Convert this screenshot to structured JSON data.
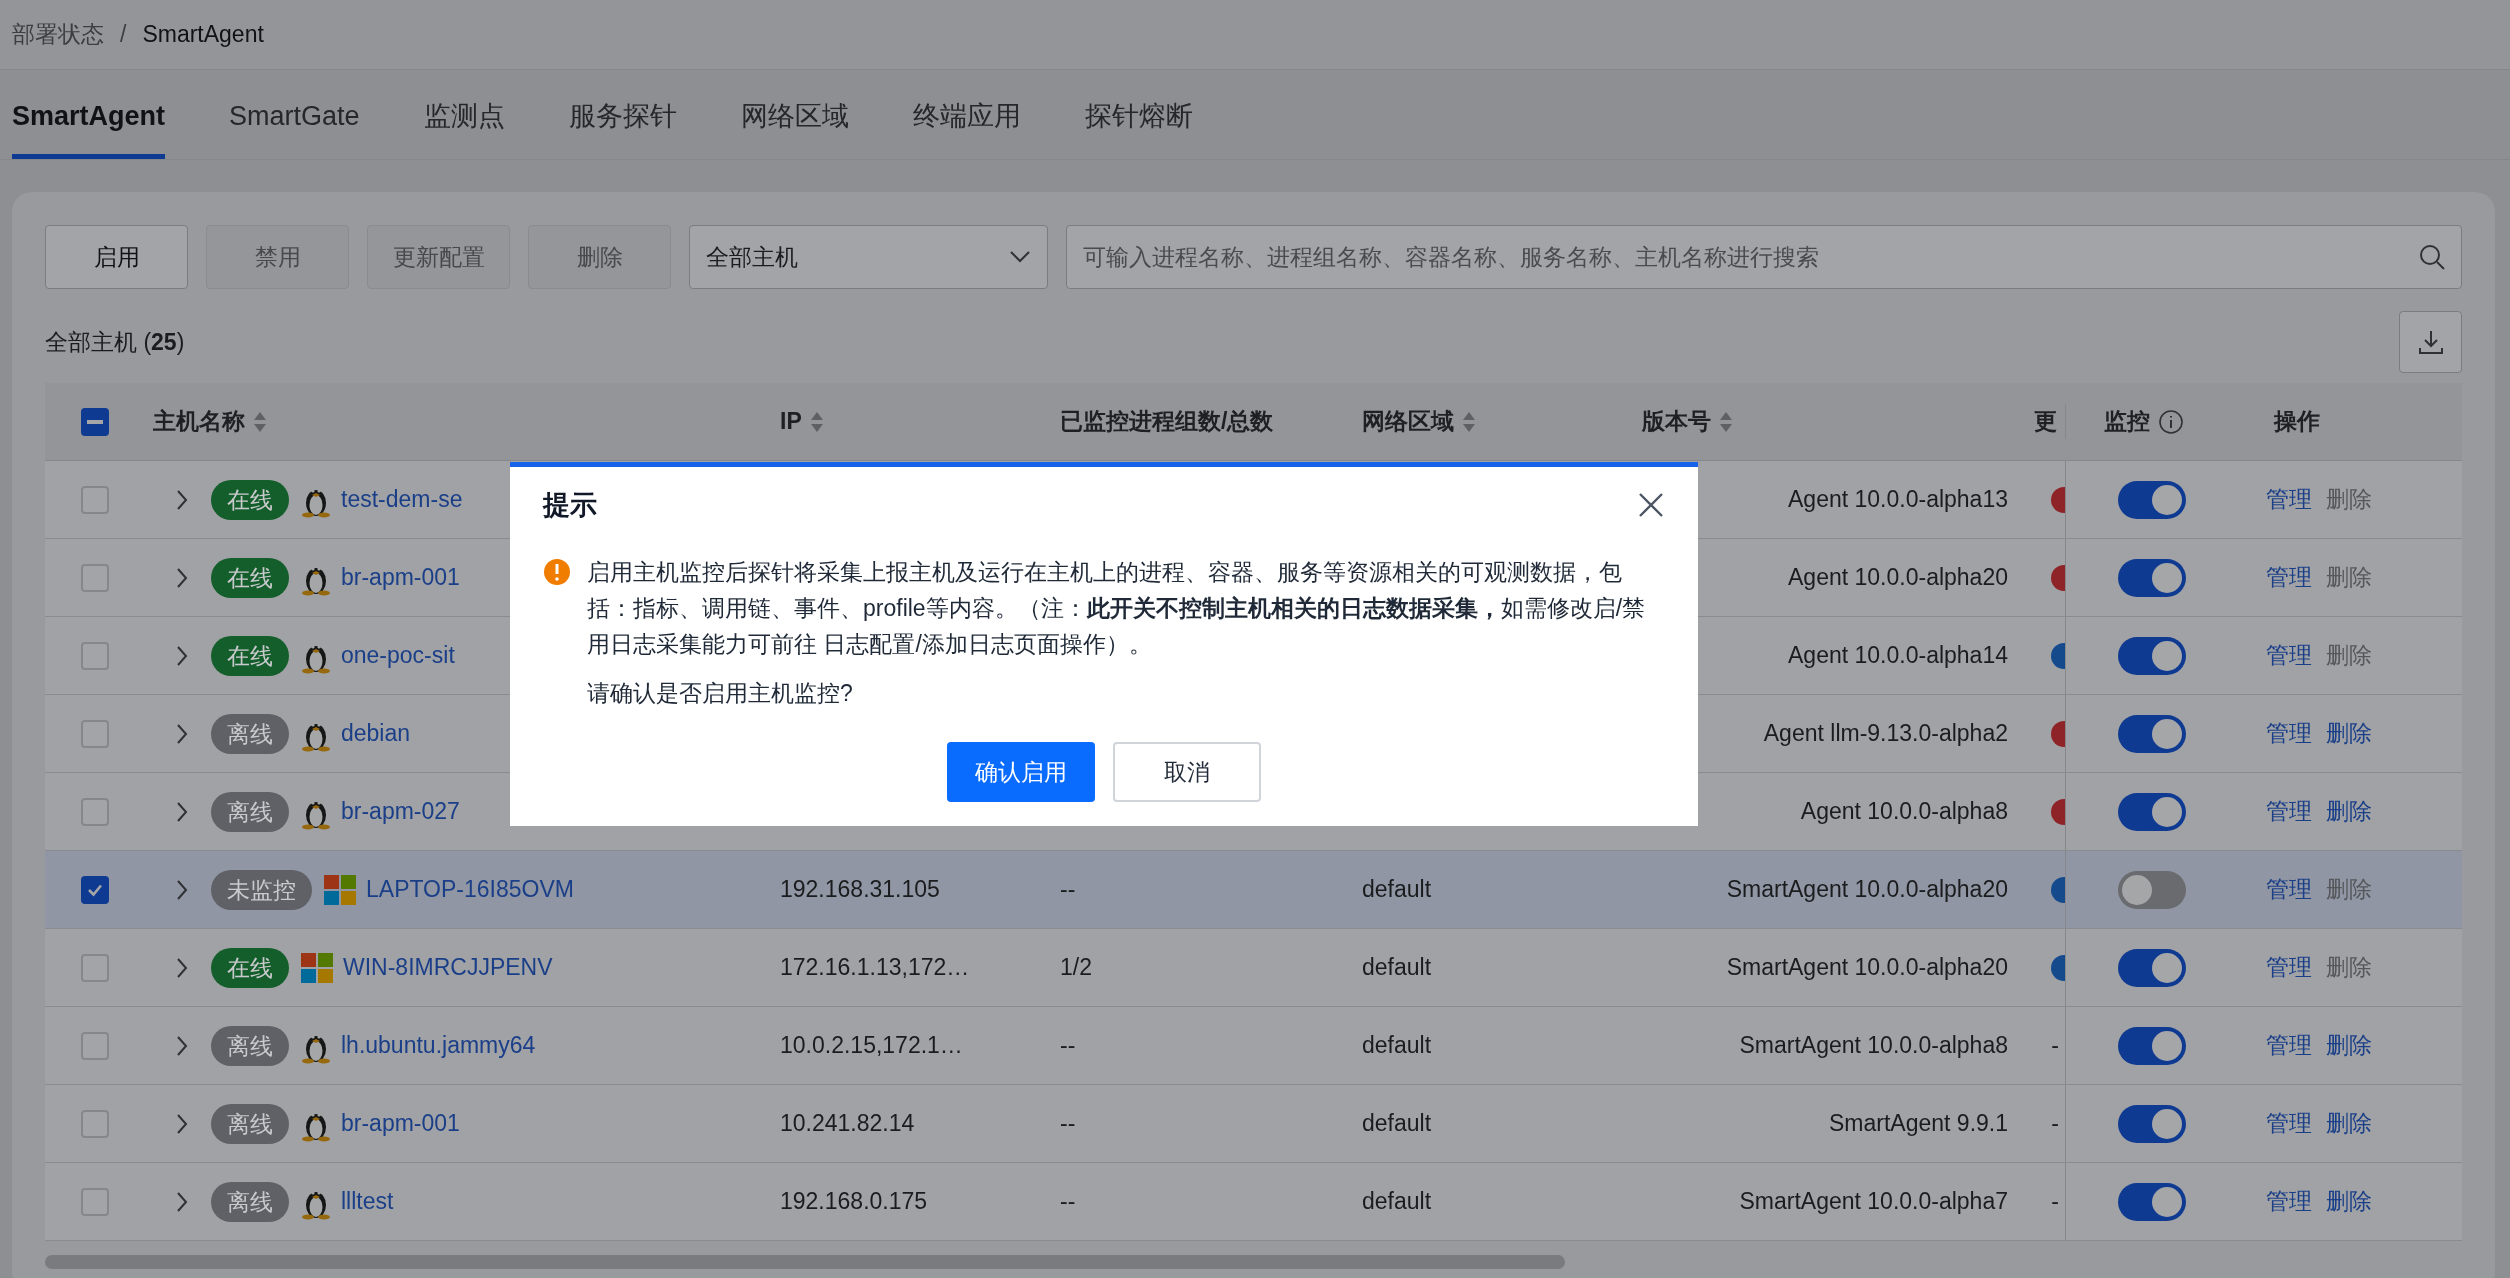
{
  "breadcrumb": [
    {
      "label": "部署状态",
      "current": false
    },
    {
      "label": "SmartAgent",
      "current": true
    }
  ],
  "breadcrumb_separator": "/",
  "tabs": [
    {
      "label": "SmartAgent",
      "selected": true
    },
    {
      "label": "SmartGate",
      "selected": false
    },
    {
      "label": "监测点",
      "selected": false
    },
    {
      "label": "服务探针",
      "selected": false
    },
    {
      "label": "网络区域",
      "selected": false
    },
    {
      "label": "终端应用",
      "selected": false
    },
    {
      "label": "探针熔断",
      "selected": false
    }
  ],
  "toolbar": {
    "buttons": [
      {
        "label": "启用",
        "disabled": false
      },
      {
        "label": "禁用",
        "disabled": true
      },
      {
        "label": "更新配置",
        "disabled": true
      },
      {
        "label": "删除",
        "disabled": true
      }
    ],
    "filter": {
      "value": "全部主机"
    },
    "search": {
      "placeholder": "可输入进程名称、进程组名称、容器名称、服务名称、主机名称进行搜索"
    }
  },
  "summary": "全部主机 (**25**)",
  "table": {
    "header_checkbox": {
      "indeterminate": true
    },
    "columns": [
      {
        "label": "主机名称",
        "sortable": true
      },
      {
        "label": "IP",
        "sortable": true
      },
      {
        "label": "已监控进程组数/总数",
        "sortable": false
      },
      {
        "label": "网络区域",
        "sortable": true
      },
      {
        "label": "版本号",
        "sortable": true
      },
      {
        "label": "更"
      },
      {
        "label": "监控",
        "sortable": false
      },
      {
        "label": "操作",
        "sortable": false
      }
    ],
    "rows": [
      {
        "checked": false,
        "status": {
          "label": "在线",
          "color": "#135e2a"
        },
        "host": {
          "kind": "linux",
          "name": "test-dem-se"
        },
        "version": "Agent 10.0.0-alpha13",
        "update": {
          "color": "#8e2428"
        },
        "monitor_on": true,
        "manage": "管理",
        "delete": {
          "label": "删除",
          "disabled": true
        }
      },
      {
        "checked": false,
        "status": {
          "label": "在线",
          "color": "#135e2a"
        },
        "host": {
          "kind": "linux",
          "name": "br-apm-001"
        },
        "version": "Agent 10.0.0-alpha20",
        "update": {
          "color": "#8e2428"
        },
        "monitor_on": true,
        "manage": "管理",
        "delete": {
          "label": "删除",
          "disabled": true
        }
      },
      {
        "checked": false,
        "status": {
          "label": "在线",
          "color": "#135e2a"
        },
        "host": {
          "kind": "linux",
          "name": "one-poc-sit"
        },
        "version": "Agent 10.0.0-alpha14",
        "update": {
          "color": "#154a8c"
        },
        "monitor_on": true,
        "manage": "管理",
        "delete": {
          "label": "删除",
          "disabled": true
        }
      },
      {
        "checked": false,
        "status": {
          "label": "离线",
          "color": "#5f6166"
        },
        "host": {
          "kind": "linux",
          "name": "debian"
        },
        "version": "Agent llm-9.13.0-alpha2",
        "update": {
          "color": "#8e2428"
        },
        "monitor_on": true,
        "manage": "管理",
        "delete": {
          "label": "删除",
          "disabled": false
        }
      },
      {
        "checked": false,
        "status": {
          "label": "离线",
          "color": "#5f6166"
        },
        "host": {
          "kind": "linux",
          "name": "br-apm-027"
        },
        "version": "Agent 10.0.0-alpha8",
        "update": {
          "color": "#8e2428"
        },
        "monitor_on": true,
        "manage": "管理",
        "delete": {
          "label": "删除",
          "disabled": false
        }
      },
      {
        "checked": true,
        "status": {
          "label": "未监控",
          "color": "#5f6166"
        },
        "host": {
          "kind": "windows",
          "name": "LAPTOP-16I85OVM"
        },
        "ip": "192.168.31.105",
        "processes": "--",
        "network": "default",
        "version": "SmartAgent 10.0.0-alpha20",
        "update": {
          "color": "#154a8c"
        },
        "monitor_on": false,
        "manage": "管理",
        "delete": {
          "label": "删除",
          "disabled": true
        }
      },
      {
        "checked": false,
        "status": {
          "label": "在线",
          "color": "#135e2a"
        },
        "host": {
          "kind": "windows",
          "name": "WIN-8IMRCJJPENV"
        },
        "ip": "172.16.1.13,172…",
        "processes": "1/2",
        "network": "default",
        "version": "SmartAgent 10.0.0-alpha20",
        "update": {
          "color": "#154a8c"
        },
        "monitor_on": true,
        "manage": "管理",
        "delete": {
          "label": "删除",
          "disabled": true
        }
      },
      {
        "checked": false,
        "status": {
          "label": "离线",
          "color": "#5f6166"
        },
        "host": {
          "kind": "linux",
          "name": "lh.ubuntu.jammy64"
        },
        "ip": "10.0.2.15,172.1…",
        "processes": "--",
        "network": "default",
        "version": "SmartAgent 10.0.0-alpha8",
        "update": {
          "text": "-"
        },
        "monitor_on": true,
        "manage": "管理",
        "delete": {
          "label": "删除",
          "disabled": false
        }
      },
      {
        "checked": false,
        "status": {
          "label": "离线",
          "color": "#5f6166"
        },
        "host": {
          "kind": "linux",
          "name": "br-apm-001"
        },
        "ip": "10.241.82.14",
        "processes": "--",
        "network": "default",
        "version": "SmartAgent 9.9.1",
        "update": {
          "text": "-"
        },
        "monitor_on": true,
        "manage": "管理",
        "delete": {
          "label": "删除",
          "disabled": false
        }
      },
      {
        "checked": false,
        "status": {
          "label": "离线",
          "color": "#5f6166"
        },
        "host": {
          "kind": "linux",
          "name": "llltest"
        },
        "ip": "192.168.0.175",
        "processes": "--",
        "network": "default",
        "version": "SmartAgent 10.0.0-alpha7",
        "update": {
          "text": "-"
        },
        "monitor_on": true,
        "manage": "管理",
        "delete": {
          "label": "删除",
          "disabled": false
        }
      }
    ]
  },
  "dialog": {
    "title": "提示",
    "message": "启用主机监控后探针将采集上报主机及运行在主机上的进程、容器、服务等资源相关的可观测数据，包括：指标、调用链、事件、profile等内容。（注：**此开关不控制主机相关的日志数据采集，**如需修改启/禁用日志采集能力可前往 日志配置/添加日志页面操作）。",
    "question": "请确认是否启用主机监控?",
    "buttons": [
      {
        "label": "确认启用",
        "kind": "primary"
      },
      {
        "label": "取消",
        "kind": "default"
      }
    ]
  }
}
